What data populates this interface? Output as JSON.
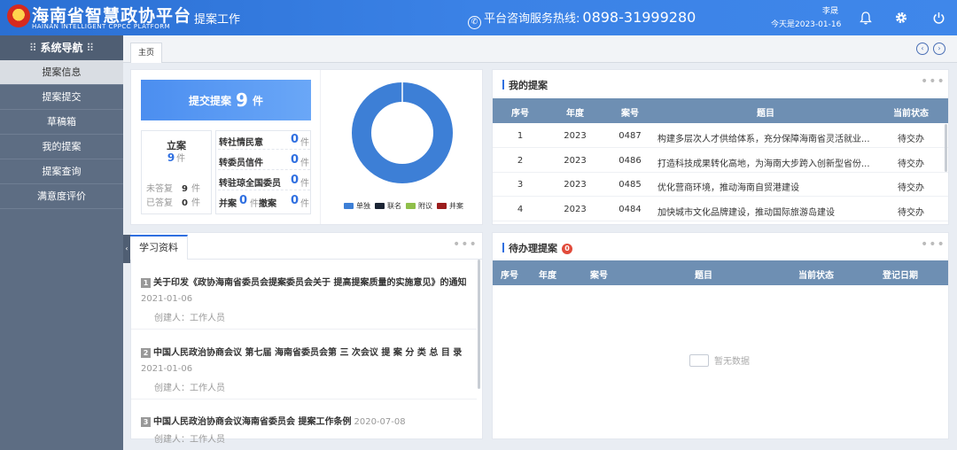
{
  "header": {
    "brand": "海南省智慧政协平台",
    "brand_en": "HAINAN INTELLIGENT CPPCC PLATFORM",
    "module": "提案工作",
    "hotline_label": "平台咨询服务热线:",
    "hotline_number": "0898-31999280",
    "user_name": "李晟",
    "today": "今天是2023-01-16",
    "icons": [
      "bell-icon",
      "gear-icon",
      "power-icon"
    ]
  },
  "sidebar": {
    "title": "系统导航",
    "items": [
      {
        "label": "提案信息",
        "active": true
      },
      {
        "label": "提案提交"
      },
      {
        "label": "草稿箱"
      },
      {
        "label": "我的提案"
      },
      {
        "label": "提案查询"
      },
      {
        "label": "满意度评价"
      }
    ]
  },
  "tabs": {
    "home": "主页"
  },
  "summary": {
    "submit_label": "提交提案",
    "submit_count": "9",
    "submit_unit": "件",
    "lian_label": "立案",
    "lian_count": "9",
    "unit": "件",
    "unanswered_label": "未答复",
    "unanswered_count": "9",
    "answered_label": "已答复",
    "answered_count": "0",
    "transfers": [
      {
        "label": "转社情民意",
        "value": "0"
      },
      {
        "label": "转委员信件",
        "value": "0"
      },
      {
        "label": "转驻琼全国委员",
        "value": "0"
      }
    ],
    "merge_label": "并案",
    "merge_value": "0",
    "withdraw_label": "撤案",
    "withdraw_value": "0"
  },
  "chart_data": {
    "type": "pie",
    "categories": [
      "单独",
      "联名",
      "附议",
      "并案"
    ],
    "values": [
      9,
      0,
      0,
      0
    ],
    "colors": [
      "#3d7fd6",
      "#1b2434",
      "#8fbf4a",
      "#9b1c1c"
    ],
    "legend_position": "bottom"
  },
  "my_proposals": {
    "title": "我的提案",
    "columns": [
      "序号",
      "年度",
      "案号",
      "题目",
      "当前状态"
    ],
    "rows": [
      [
        "1",
        "2023",
        "0487",
        "构建多层次人才供给体系，充分保障海南省灵活就业...",
        "待交办"
      ],
      [
        "2",
        "2023",
        "0486",
        "打造科技成果转化高地，为海南大步跨入创新型省份...",
        "待交办"
      ],
      [
        "3",
        "2023",
        "0485",
        "优化营商环境，推动海南自贸港建设",
        "待交办"
      ],
      [
        "4",
        "2023",
        "0484",
        "加快城市文化品牌建设，推动国际旅游岛建设",
        "待交办"
      ]
    ]
  },
  "study": {
    "tab": "学习资料",
    "items": [
      {
        "index": "1",
        "title": "关于印发《政协海南省委员会提案委员会关于 提高提案质量的实施意见》的通知",
        "date": "2021-01-06",
        "creator": "创建人：工作人员"
      },
      {
        "index": "2",
        "title": "中国人民政治协商会议 第七届 海南省委员会第 三 次会议 提 案 分 类 总 目 录",
        "date": "2021-01-06",
        "creator": "创建人：工作人员"
      },
      {
        "index": "3",
        "title": "中国人民政治协商会议海南省委员会 提案工作条例",
        "date": "2020-07-08",
        "creator": "创建人：工作人员"
      }
    ]
  },
  "pending": {
    "title": "待办理提案",
    "count": "0",
    "columns": [
      "序号",
      "年度",
      "案号",
      "题目",
      "当前状态",
      "登记日期"
    ],
    "empty_text": "暂无数据"
  }
}
